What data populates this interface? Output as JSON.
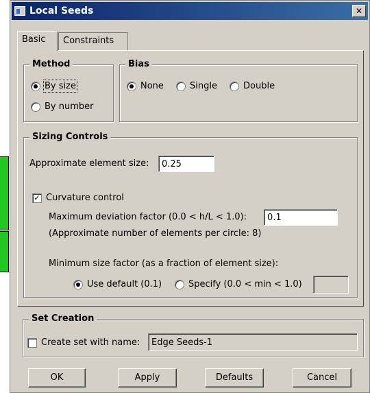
{
  "window": {
    "title": "Local Seeds",
    "close_glyph": "✕"
  },
  "tabs": [
    {
      "label": "Basic"
    },
    {
      "label": "Constraints"
    }
  ],
  "method": {
    "title": "Method",
    "options": [
      {
        "label": "By size",
        "selected": true
      },
      {
        "label": "By number",
        "selected": false
      }
    ]
  },
  "bias": {
    "title": "Bias",
    "options": [
      {
        "label": "None",
        "selected": true
      },
      {
        "label": "Single",
        "selected": false
      },
      {
        "label": "Double",
        "selected": false
      }
    ]
  },
  "sizing": {
    "title": "Sizing Controls",
    "element_size_label": "Approximate element size:",
    "element_size_value": "0.25",
    "curvature_label": "Curvature control",
    "curvature_checked": true,
    "deviation_label": "Maximum deviation factor (0.0 < h/L < 1.0):",
    "deviation_value": "0.1",
    "elements_per_circle_note": "(Approximate number of elements per circle: 8)",
    "min_size_label": "Minimum size factor (as a fraction of element size):",
    "use_default_label": "Use default (0.1)",
    "specify_label": "Specify (0.0 < min < 1.0)",
    "specify_value": ""
  },
  "set_creation": {
    "title": "Set Creation",
    "create_set_label": "Create set with name:",
    "create_set_checked": false,
    "set_name_value": "Edge Seeds-1"
  },
  "buttons": {
    "ok": "OK",
    "apply": "Apply",
    "defaults": "Defaults",
    "cancel": "Cancel"
  }
}
